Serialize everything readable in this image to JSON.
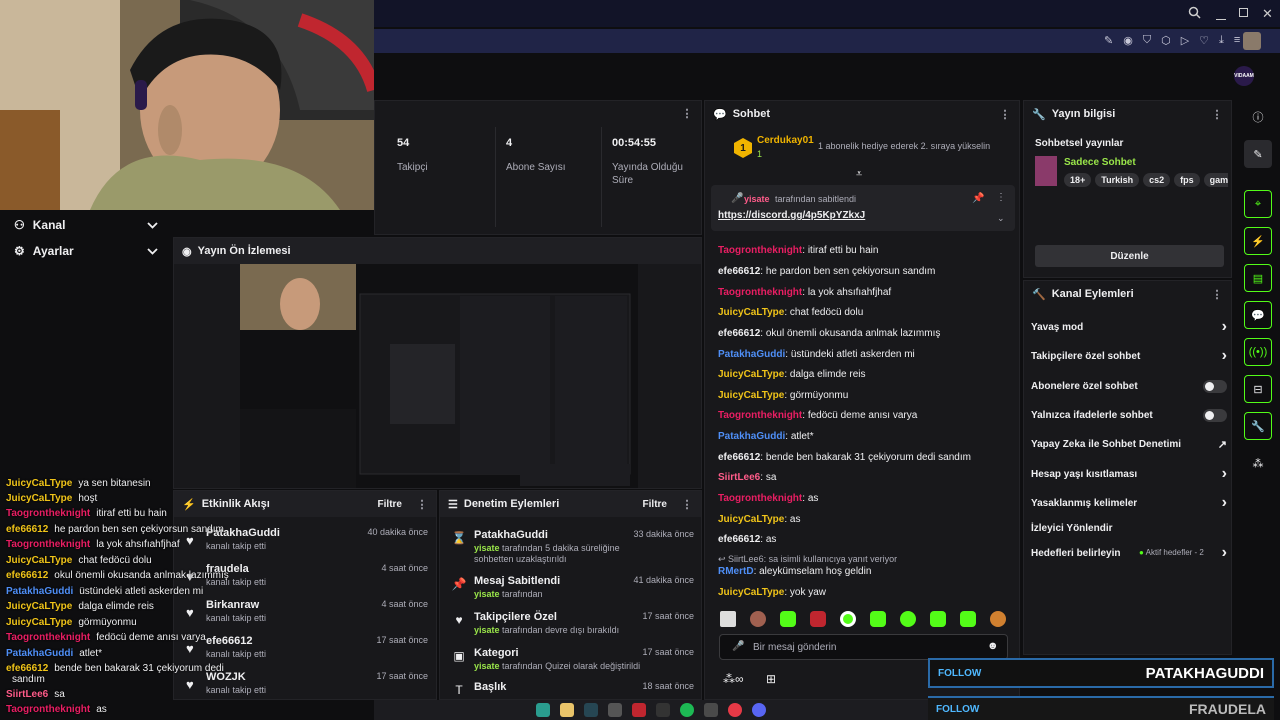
{
  "header": {
    "avatar_badge": "VIDAAM"
  },
  "nav": {
    "channel": "Kanal",
    "settings": "Ayarlar"
  },
  "stats": [
    {
      "value": "54",
      "label": "Takipçi"
    },
    {
      "value": "4",
      "label": "Abone Sayısı"
    },
    {
      "value": "00:54:55",
      "label": "Yayında Olduğu Süre"
    }
  ],
  "preview": {
    "title": "Yayın Ön İzlemesi"
  },
  "activity": {
    "title": "Etkinlik Akışı",
    "filter": "Filtre",
    "items": [
      {
        "name": "PatakhaGuddi",
        "sub": "kanalı takip etti",
        "time": "40 dakika önce"
      },
      {
        "name": "fraudela",
        "sub": "kanalı takip etti",
        "time": "4 saat önce"
      },
      {
        "name": "Birkanraw",
        "sub": "kanalı takip etti",
        "time": "4 saat önce"
      },
      {
        "name": "efe66612",
        "sub": "kanalı takip etti",
        "time": "17 saat önce"
      },
      {
        "name": "WOZJK",
        "sub": "kanalı takip etti",
        "time": "17 saat önce"
      }
    ]
  },
  "moderation": {
    "title": "Denetim Eylemleri",
    "filter": "Filtre",
    "items": [
      {
        "name": "PatakhaGuddi",
        "actor": "yisate",
        "sub": " tarafından 5 dakika süreliğine sohbetten uzaklaştırıldı",
        "time": "33 dakika önce",
        "icon": "hourglass-icon"
      },
      {
        "name": "Mesaj Sabitlendi",
        "actor": "yisate",
        "sub": " tarafından",
        "time": "41 dakika önce",
        "icon": "pin-icon"
      },
      {
        "name": "Takipçilere Özel",
        "actor": "yisate",
        "sub": " tarafından devre dışı bırakıldı",
        "time": "17 saat önce",
        "icon": "heart-icon"
      },
      {
        "name": "Kategori",
        "actor": "yisate",
        "sub": " tarafından Quizei olarak değiştirildi",
        "time": "17 saat önce",
        "icon": "category-icon"
      },
      {
        "name": "Başlık",
        "actor": "",
        "sub": "",
        "time": "18 saat önce",
        "icon": "title-icon"
      }
    ]
  },
  "chat": {
    "title": "Sohbet",
    "gift_user": "Cerdukay01",
    "gift_rank": "1",
    "gift_count": "1",
    "gift_text": "1 abonelik hediye ederek 2. sıraya yükselin",
    "pinned_by": "yisate",
    "pinned_suffix": "tarafından sabitlendi",
    "pinned_link": "https://discord.gg/4p5KpYZkxJ",
    "messages": [
      {
        "user": "Taogrontheknight",
        "color": "#e91e63",
        "text": "itiraf etti bu hain"
      },
      {
        "user": "efe66612",
        "color": "#efeff1",
        "text": "he pardon ben sen çekiyorsun sandım"
      },
      {
        "user": "Taogrontheknight",
        "color": "#e91e63",
        "text": "la yok ahsıfıahfjhaf"
      },
      {
        "user": "JuicyCaLType",
        "color": "#f0c419",
        "text": "chat fedöcü dolu"
      },
      {
        "user": "efe66612",
        "color": "#efeff1",
        "text": "okul önemli okusanda anlmak lazımmış"
      },
      {
        "user": "PatakhaGuddi",
        "color": "#4f8ff7",
        "text": "üstündeki atleti askerden mi"
      },
      {
        "user": "JuicyCaLType",
        "color": "#f0c419",
        "text": "dalga elimde reis"
      },
      {
        "user": "JuicyCaLType",
        "color": "#f0c419",
        "text": "görmüyonmu"
      },
      {
        "user": "Taogrontheknight",
        "color": "#e91e63",
        "text": "fedöcü deme anısı varya"
      },
      {
        "user": "PatakhaGuddi",
        "color": "#4f8ff7",
        "text": "atlet*"
      },
      {
        "user": "efe66612",
        "color": "#efeff1",
        "text": "bende ben bakarak 31 çekiyorum dedi sandım"
      },
      {
        "user": "SiirtLee6",
        "color": "#ff5c8a",
        "text": "sa"
      },
      {
        "user": "Taogrontheknight",
        "color": "#e91e63",
        "text": "as"
      },
      {
        "user": "JuicyCaLType",
        "color": "#f0c419",
        "text": "as"
      },
      {
        "user": "efe66612",
        "color": "#efeff1",
        "text": "as"
      }
    ],
    "reply_hint": "SiirtLee6: sa isimli kullanıcıya yanıt veriyor",
    "reply_user": "RMertD",
    "reply_text": "aleykümselam hoş geldin",
    "last_user": "JuicyCaLType",
    "last_text": "yok yaw",
    "input_placeholder": "Bir mesaj gönderin"
  },
  "stream_info": {
    "title": "Yayın bilgisi",
    "section": "Sohbetsel yayınlar",
    "category": "Sadece Sohbet",
    "tags": [
      "18+",
      "Turkish",
      "cs2",
      "fps",
      "gamin"
    ],
    "edit": "Düzenle"
  },
  "channel_actions": {
    "title": "Kanal Eylemleri",
    "items": [
      {
        "label": "Yavaş mod",
        "ctrl": "chevron"
      },
      {
        "label": "Takipçilere özel sohbet",
        "ctrl": "chevron"
      },
      {
        "label": "Abonelere özel sohbet",
        "ctrl": "toggle"
      },
      {
        "label": "Yalnızca ifadelerle sohbet",
        "ctrl": "toggle"
      },
      {
        "label": "Yapay Zeka ile Sohbet Denetimi",
        "ctrl": "external"
      },
      {
        "label": "Hesap yaşı kısıtlaması",
        "ctrl": "chevron"
      },
      {
        "label": "Yasaklanmış kelimeler",
        "ctrl": "chevron"
      },
      {
        "label": "İzleyici Yönlendir",
        "ctrl": "none"
      },
      {
        "label": "Hedefleri belirleyin",
        "ctrl": "chevron"
      }
    ],
    "goals_badge": "Aktif hedefler - 2"
  },
  "overlay_chat": [
    {
      "user": "JuicyCaLType",
      "color": "#f0c419",
      "text": "ya sen bitanesin"
    },
    {
      "user": "JuicyCaLType",
      "color": "#f0c419",
      "text": "hoşt"
    },
    {
      "user": "Taogrontheknight",
      "color": "#e91e63",
      "text": "itiraf etti bu hain"
    },
    {
      "user": "efe66612",
      "color": "#f0c419",
      "text": "he pardon ben sen çekiyorsun sandım"
    },
    {
      "user": "Taogrontheknight",
      "color": "#e91e63",
      "text": "la yok ahsıfıahfjhaf"
    },
    {
      "user": "JuicyCaLType",
      "color": "#f0c419",
      "text": "chat fedöcü dolu"
    },
    {
      "user": "efe66612",
      "color": "#f0c419",
      "text": "okul önemli okusanda anlmak lazımmış"
    },
    {
      "user": "PatakhaGuddi",
      "color": "#4f8ff7",
      "text": "üstündeki atleti askerden mi"
    },
    {
      "user": "JuicyCaLType",
      "color": "#f0c419",
      "text": "dalga elimde reis"
    },
    {
      "user": "JuicyCaLType",
      "color": "#f0c419",
      "text": "görmüyonmu"
    },
    {
      "user": "Taogrontheknight",
      "color": "#e91e63",
      "text": "fedöcü deme anısı varya"
    },
    {
      "user": "PatakhaGuddi",
      "color": "#4f8ff7",
      "text": "atlet*"
    },
    {
      "user": "efe66612",
      "color": "#f0c419",
      "text": "bende ben bakarak 31 çekiyorum dedi"
    },
    {
      "user": "",
      "color": "#efeff1",
      "text": "sandım"
    },
    {
      "user": "SiirtLee6",
      "color": "#ff5c8a",
      "text": "sa"
    },
    {
      "user": "Taogrontheknight",
      "color": "#e91e63",
      "text": "as"
    }
  ],
  "follow_alerts": [
    {
      "label": "FOLLOW",
      "name": "PATAKHAGUDDI"
    },
    {
      "label": "FOLLOW",
      "name": "FRAUDELA"
    }
  ],
  "colors": {
    "accent": "#9ae64a",
    "brand_green": "#53fc18",
    "bg": "#0e0e10",
    "panel": "#18181b"
  }
}
